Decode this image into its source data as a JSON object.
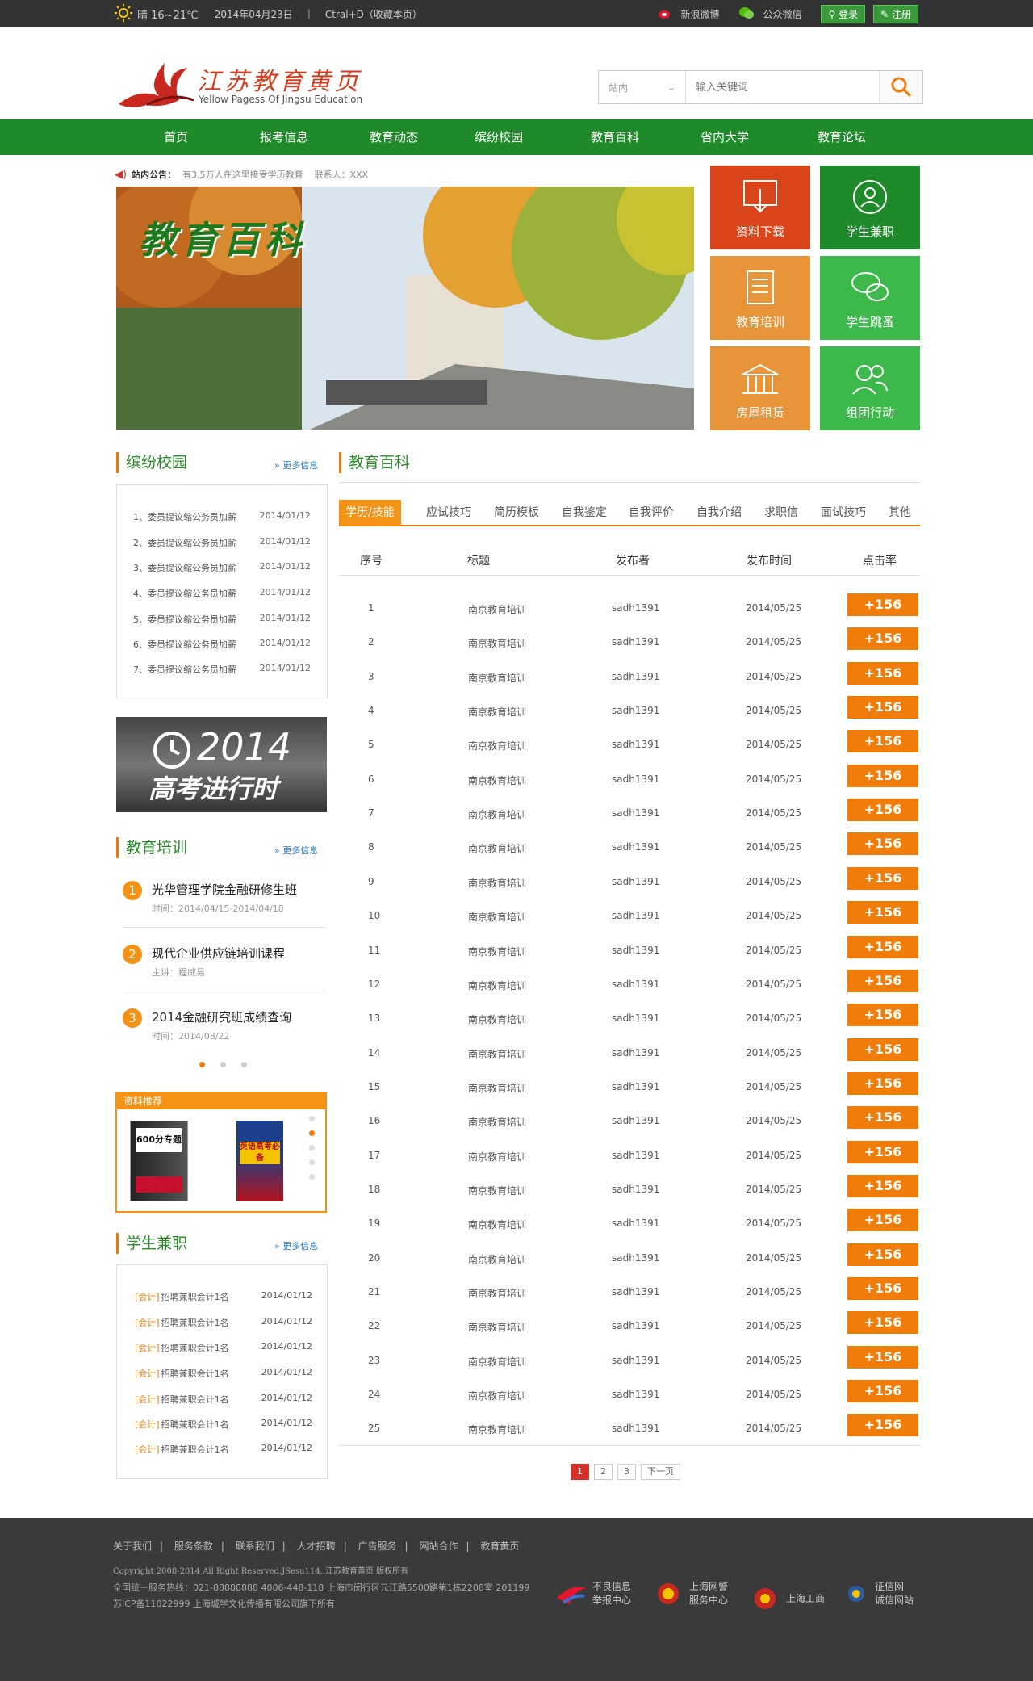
{
  "topbar": {
    "weather": "晴 16~21℃",
    "date": "2014年04月23日",
    "bookmark": "Ctral+D（收藏本页）",
    "weibo": "新浪微博",
    "wechat": "公众微信",
    "login": "登录",
    "register": "注册"
  },
  "logo": {
    "cn": "江苏教育黄页",
    "en": "Yellow Pagess Of Jingsu Education"
  },
  "search": {
    "scope": "站内",
    "placeholder": "输入关键词"
  },
  "nav": [
    "首页",
    "报考信息",
    "教育动态",
    "缤纷校园",
    "教育百科",
    "省内大学",
    "教育论坛"
  ],
  "notice": {
    "label": "站内公告：",
    "text": "有3.5万人在这里接受学历教育",
    "contact": "联系人：XXX"
  },
  "banner": {
    "title": "教育百科"
  },
  "tiles": [
    "资料下载",
    "学生兼职",
    "教育培训",
    "学生跳蚤",
    "房屋租赁",
    "组团行动"
  ],
  "colors": {
    "green": "#1f8a2a",
    "orange": "#f39214",
    "tile_red": "#d9441a",
    "tile_green": "#1f8a2a",
    "tile_orange": "#e8953a",
    "tile_lightgreen": "#3db84a"
  },
  "campus": {
    "title": "缤纷校园",
    "more": "更多信息",
    "items": [
      {
        "t": "1、委员提议缩公务员加薪",
        "d": "2014/01/12"
      },
      {
        "t": "2、委员提议缩公务员加薪",
        "d": "2014/01/12"
      },
      {
        "t": "3、委员提议缩公务员加薪",
        "d": "2014/01/12"
      },
      {
        "t": "4、委员提议缩公务员加薪",
        "d": "2014/01/12"
      },
      {
        "t": "5、委员提议缩公务员加薪",
        "d": "2014/01/12"
      },
      {
        "t": "6、委员提议缩公务员加薪",
        "d": "2014/01/12"
      },
      {
        "t": "7、委员提议缩公务员加薪",
        "d": "2014/01/12"
      }
    ]
  },
  "promo": {
    "year": "2014",
    "text": "高考进行时"
  },
  "training": {
    "title": "教育培训",
    "more": "更多信息",
    "items": [
      {
        "n": "1",
        "t": "光华管理学院金融研修生班",
        "s": "时间：2014/04/15-2014/04/18"
      },
      {
        "n": "2",
        "t": "现代企业供应链培训课程",
        "s": "主讲：程威易"
      },
      {
        "n": "3",
        "t": "2014金融研究班成绩查询",
        "s": "时间：2014/08/22"
      }
    ]
  },
  "recommend": {
    "title": "资料推荐",
    "book1": "600分专题",
    "book2": "英语高考必备"
  },
  "jobs": {
    "title": "学生兼职",
    "more": "更多信息",
    "tag": "[会计]",
    "items": [
      {
        "t": "招聘兼职会计1名",
        "d": "2014/01/12"
      },
      {
        "t": "招聘兼职会计1名",
        "d": "2014/01/12"
      },
      {
        "t": "招聘兼职会计1名",
        "d": "2014/01/12"
      },
      {
        "t": "招聘兼职会计1名",
        "d": "2014/01/12"
      },
      {
        "t": "招聘兼职会计1名",
        "d": "2014/01/12"
      },
      {
        "t": "招聘兼职会计1名",
        "d": "2014/01/12"
      },
      {
        "t": "招聘兼职会计1名",
        "d": "2014/01/12"
      }
    ]
  },
  "main": {
    "title": "教育百科",
    "tabs": [
      "学历/技能",
      "应试技巧",
      "简历模板",
      "自我鉴定",
      "自我评价",
      "自我介绍",
      "求职信",
      "面试技巧",
      "其他"
    ],
    "headers": [
      "序号",
      "标题",
      "发布者",
      "发布时间",
      "点击率"
    ],
    "row_title": "南京教育培训",
    "row_author": "sadh1391",
    "row_date": "2014/05/25",
    "row_click": "+156",
    "row_count": 25
  },
  "pager": [
    "1",
    "2",
    "3",
    "下一页"
  ],
  "footer": {
    "links": [
      "关于我们",
      "服务条款",
      "联系我们",
      "人才招聘",
      "广告服务",
      "网站合作",
      "教育黄页"
    ],
    "copyright": "Copyright 2008-2014 All Right Reserved.JSesu114..江苏教育黄页 版权所有",
    "hotline": "全国统一服务热线：021-88888888 4006-448-118   上海市闵行区元江路5500路第1栋2208室 201199",
    "icp": "苏ICP备11022999    上海城学文化传播有限公司旗下所有",
    "badges": [
      [
        "不良信息",
        "举报中心"
      ],
      [
        "上海网警",
        "服务中心"
      ],
      [
        "上海工商",
        ""
      ],
      [
        "征信网",
        "诚信网站"
      ]
    ]
  }
}
